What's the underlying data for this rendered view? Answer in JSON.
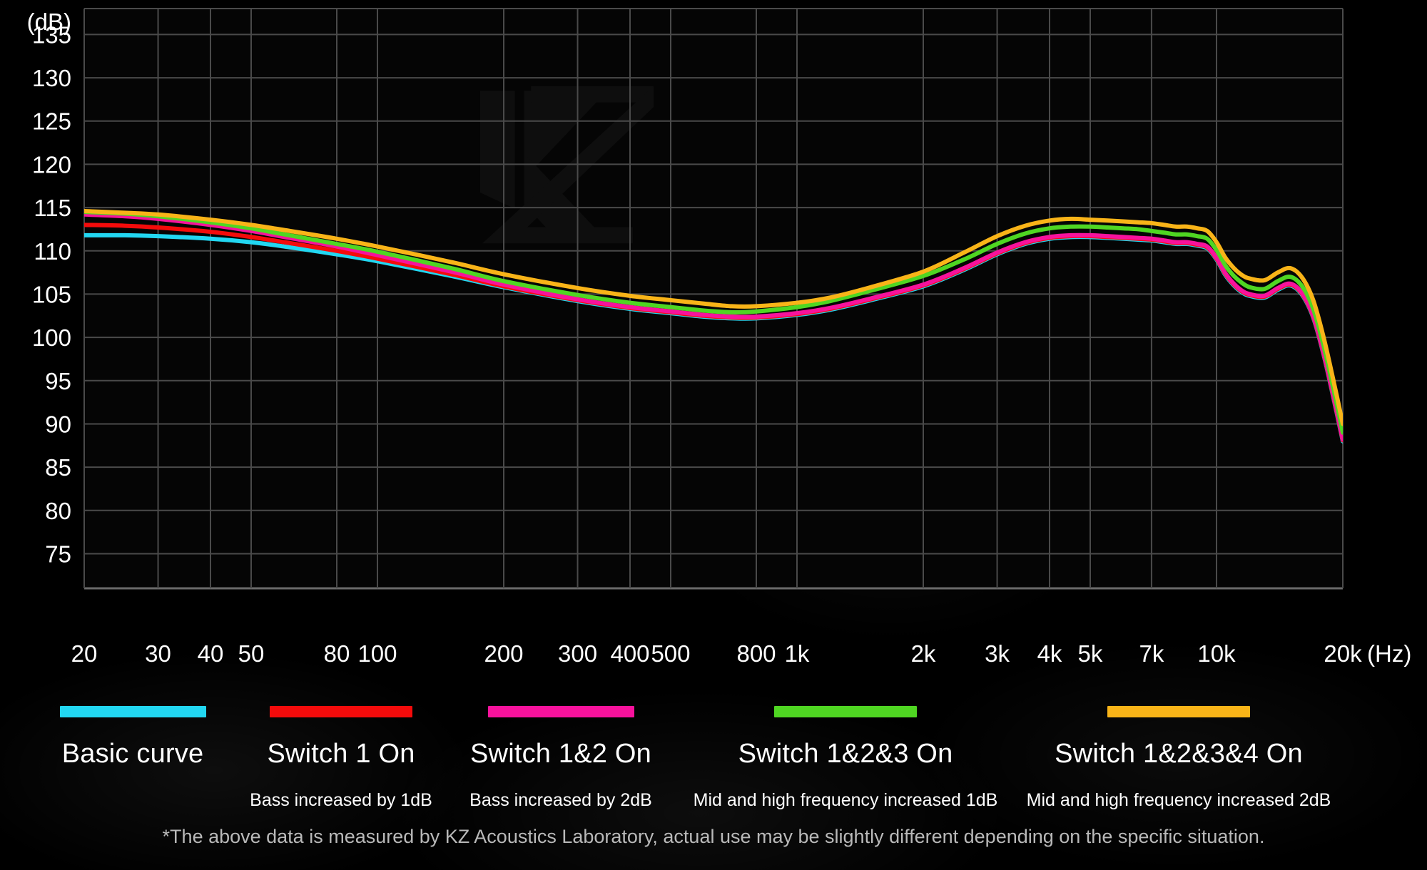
{
  "axes": {
    "y_unit": "(dB)",
    "x_unit": "(Hz)",
    "y_ticks": [
      "135",
      "130",
      "125",
      "120",
      "115",
      "110",
      "105",
      "100",
      "95",
      "90",
      "85",
      "80",
      "75"
    ],
    "x_ticks": [
      "20",
      "30",
      "40",
      "50",
      "80",
      "100",
      "200",
      "300",
      "400",
      "500",
      "800",
      "1k",
      "2k",
      "3k",
      "4k",
      "5k",
      "7k",
      "10k",
      "20k"
    ]
  },
  "watermark": "kz-logo",
  "legend": {
    "items": [
      {
        "label": "Basic curve",
        "sub": "",
        "color": "#22D7F2"
      },
      {
        "label": "Switch 1 On",
        "sub": "Bass increased by 1dB",
        "color": "#F40B0B"
      },
      {
        "label": "Switch 1&2 On",
        "sub": "Bass increased by 2dB",
        "color": "#F7129C"
      },
      {
        "label": "Switch 1&2&3 On",
        "sub": "Mid and high frequency increased 1dB",
        "color": "#4FD622"
      },
      {
        "label": "Switch 1&2&3&4 On",
        "sub": "Mid and high frequency increased 2dB",
        "color": "#F9B418"
      }
    ]
  },
  "footnote": "*The above data is measured by KZ Acoustics Laboratory, actual use may be slightly different depending on the specific situation.",
  "chart_data": {
    "type": "line",
    "title": "",
    "xlabel": "(Hz)",
    "ylabel": "(dB)",
    "xscale": "log",
    "xlim": [
      20,
      20000
    ],
    "ylim": [
      71,
      138
    ],
    "grid": true,
    "legend_position": "bottom",
    "x": [
      20,
      25,
      30,
      40,
      50,
      60,
      80,
      100,
      150,
      200,
      300,
      400,
      500,
      600,
      700,
      800,
      1000,
      1200,
      1500,
      2000,
      2500,
      3000,
      3500,
      4000,
      4500,
      5000,
      5500,
      6000,
      6500,
      7000,
      7500,
      8000,
      8500,
      9000,
      9500,
      10000,
      10500,
      11000,
      11500,
      12000,
      13000,
      14000,
      15000,
      16000,
      17000,
      18000,
      19000,
      20000
    ],
    "series": [
      {
        "name": "Basic curve",
        "color": "#22D7F2",
        "values": [
          111.8,
          111.8,
          111.7,
          111.4,
          111.0,
          110.5,
          109.6,
          108.8,
          107.1,
          105.8,
          104.2,
          103.3,
          102.8,
          102.4,
          102.2,
          102.2,
          102.6,
          103.2,
          104.3,
          105.9,
          107.8,
          109.6,
          110.8,
          111.4,
          111.6,
          111.6,
          111.5,
          111.4,
          111.3,
          111.2,
          111.0,
          110.8,
          110.8,
          110.6,
          110.3,
          109.0,
          107.2,
          106.0,
          105.2,
          104.8,
          104.6,
          105.5,
          106.0,
          104.9,
          102.3,
          98.0,
          93.0,
          88.0
        ]
      },
      {
        "name": "Switch 1 On",
        "color": "#F40B0B",
        "values": [
          113.0,
          112.9,
          112.7,
          112.2,
          111.6,
          111.0,
          110.0,
          109.1,
          107.3,
          105.9,
          104.3,
          103.4,
          102.9,
          102.5,
          102.3,
          102.3,
          102.7,
          103.3,
          104.4,
          106.0,
          107.9,
          109.7,
          110.9,
          111.5,
          111.7,
          111.7,
          111.6,
          111.5,
          111.4,
          111.3,
          111.1,
          110.9,
          110.9,
          110.7,
          110.4,
          109.1,
          107.3,
          106.1,
          105.3,
          104.9,
          104.7,
          105.6,
          106.1,
          105.0,
          102.4,
          98.1,
          93.1,
          88.1
        ]
      },
      {
        "name": "Switch 1&2 On",
        "color": "#F7129C",
        "values": [
          114.2,
          114.0,
          113.7,
          113.0,
          112.3,
          111.6,
          110.5,
          109.5,
          107.6,
          106.1,
          104.4,
          103.5,
          103.0,
          102.6,
          102.4,
          102.4,
          102.8,
          103.4,
          104.5,
          106.1,
          108.0,
          109.8,
          111.0,
          111.6,
          111.8,
          111.8,
          111.7,
          111.6,
          111.5,
          111.4,
          111.2,
          111.0,
          111.0,
          110.8,
          110.5,
          109.2,
          107.4,
          106.2,
          105.4,
          105.0,
          104.8,
          105.7,
          106.2,
          105.1,
          102.5,
          98.2,
          93.2,
          88.2
        ]
      },
      {
        "name": "Switch 1&2&3 On",
        "color": "#4FD622",
        "values": [
          114.5,
          114.3,
          114.0,
          113.3,
          112.6,
          111.9,
          110.8,
          109.9,
          108.0,
          106.5,
          104.9,
          104.0,
          103.5,
          103.1,
          102.9,
          103.0,
          103.5,
          104.2,
          105.4,
          107.1,
          109.0,
          110.8,
          112.0,
          112.6,
          112.8,
          112.8,
          112.7,
          112.6,
          112.5,
          112.3,
          112.1,
          111.9,
          111.9,
          111.7,
          111.4,
          110.1,
          108.3,
          107.1,
          106.3,
          105.8,
          105.6,
          106.5,
          107.0,
          105.9,
          103.3,
          99.0,
          94.0,
          89.0
        ]
      },
      {
        "name": "Switch 1&2&3&4 On",
        "color": "#F9B418",
        "values": [
          114.6,
          114.4,
          114.2,
          113.6,
          113.0,
          112.4,
          111.4,
          110.5,
          108.7,
          107.3,
          105.7,
          104.8,
          104.3,
          103.9,
          103.6,
          103.6,
          104.0,
          104.6,
          105.8,
          107.6,
          109.8,
          111.7,
          112.9,
          113.5,
          113.7,
          113.6,
          113.5,
          113.4,
          113.3,
          113.2,
          113.0,
          112.8,
          112.8,
          112.6,
          112.3,
          111.0,
          109.2,
          108.0,
          107.2,
          106.8,
          106.6,
          107.5,
          108.0,
          106.9,
          104.3,
          100.0,
          95.0,
          90.0
        ]
      }
    ]
  }
}
